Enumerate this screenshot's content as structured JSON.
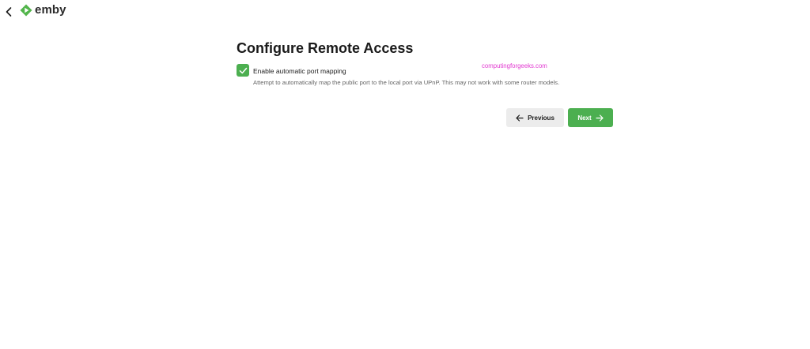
{
  "header": {
    "logo_text": "emby",
    "brand_color": "#52b54b",
    "back_icon": "chevron-left-icon"
  },
  "page": {
    "title": "Configure Remote Access"
  },
  "port_mapping": {
    "label": "Enable automatic port mapping",
    "checked": true,
    "helper": "Attempt to automatically map the public port to the local port via UPnP. This may not work with some router models."
  },
  "watermark": "computingforgeeks.com",
  "buttons": {
    "previous_label": "Previous",
    "previous_icon": "arrow-left-icon",
    "next_label": "Next",
    "next_icon": "arrow-right-icon",
    "accent_color": "#4caf50"
  }
}
